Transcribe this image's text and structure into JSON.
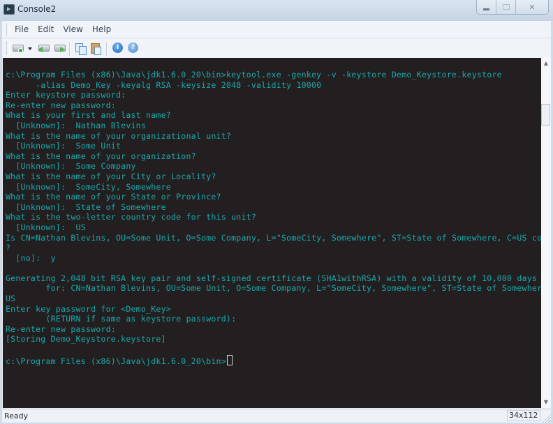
{
  "window": {
    "title": "Console2",
    "controls": [
      "minimize",
      "maximize",
      "close"
    ]
  },
  "menu": {
    "items": [
      {
        "label": "File"
      },
      {
        "label": "Edit"
      },
      {
        "label": "View"
      },
      {
        "label": "Help"
      }
    ]
  },
  "toolbar": {
    "buttons": [
      {
        "icon": "new-tab-icon"
      },
      {
        "icon": "dropdown-arrow-icon"
      },
      {
        "icon": "previous-tab-icon"
      },
      {
        "icon": "next-tab-icon"
      },
      {
        "icon": "copy-icon"
      },
      {
        "icon": "paste-icon"
      },
      {
        "icon": "info-icon"
      },
      {
        "icon": "help-icon"
      }
    ]
  },
  "colors": {
    "terminal_bg": "#231f20",
    "terminal_fg": "#19a9ac"
  },
  "terminal": {
    "lines": [
      "c:\\Program Files (x86)\\Java\\jdk1.6.0_20\\bin>keytool.exe -genkey -v -keystore Demo_Keystore.keystore",
      "      -alias Demo_Key -keyalg RSA -keysize 2048 -validity 10000",
      "Enter keystore password:",
      "Re-enter new password:",
      "What is your first and last name?",
      "  [Unknown]:  Nathan Blevins",
      "What is the name of your organizational unit?",
      "  [Unknown]:  Some Unit",
      "What is the name of your organization?",
      "  [Unknown]:  Some Company",
      "What is the name of your City or Locality?",
      "  [Unknown]:  SomeCity, Somewhere",
      "What is the name of your State or Province?",
      "  [Unknown]:  State of Somewhere",
      "What is the two-letter country code for this unit?",
      "  [Unknown]:  US",
      "Is CN=Nathan Blevins, OU=Some Unit, O=Some Company, L=\"SomeCity, Somewhere\", ST=State of Somewhere, C=US correct",
      "?",
      "  [no]:  y",
      "",
      "Generating 2,048 bit RSA key pair and self-signed certificate (SHA1withRSA) with a validity of 10,000 days",
      "        for: CN=Nathan Blevins, OU=Some Unit, O=Some Company, L=\"SomeCity, Somewhere\", ST=State of Somewhere, C=",
      "US",
      "Enter key password for <Demo_Key>",
      "        (RETURN if same as keystore password):",
      "Re-enter new password:",
      "[Storing Demo_Keystore.keystore]",
      "",
      "c:\\Program Files (x86)\\Java\\jdk1.6.0_20\\bin>"
    ]
  },
  "statusbar": {
    "status": "Ready",
    "size": "34x112"
  }
}
